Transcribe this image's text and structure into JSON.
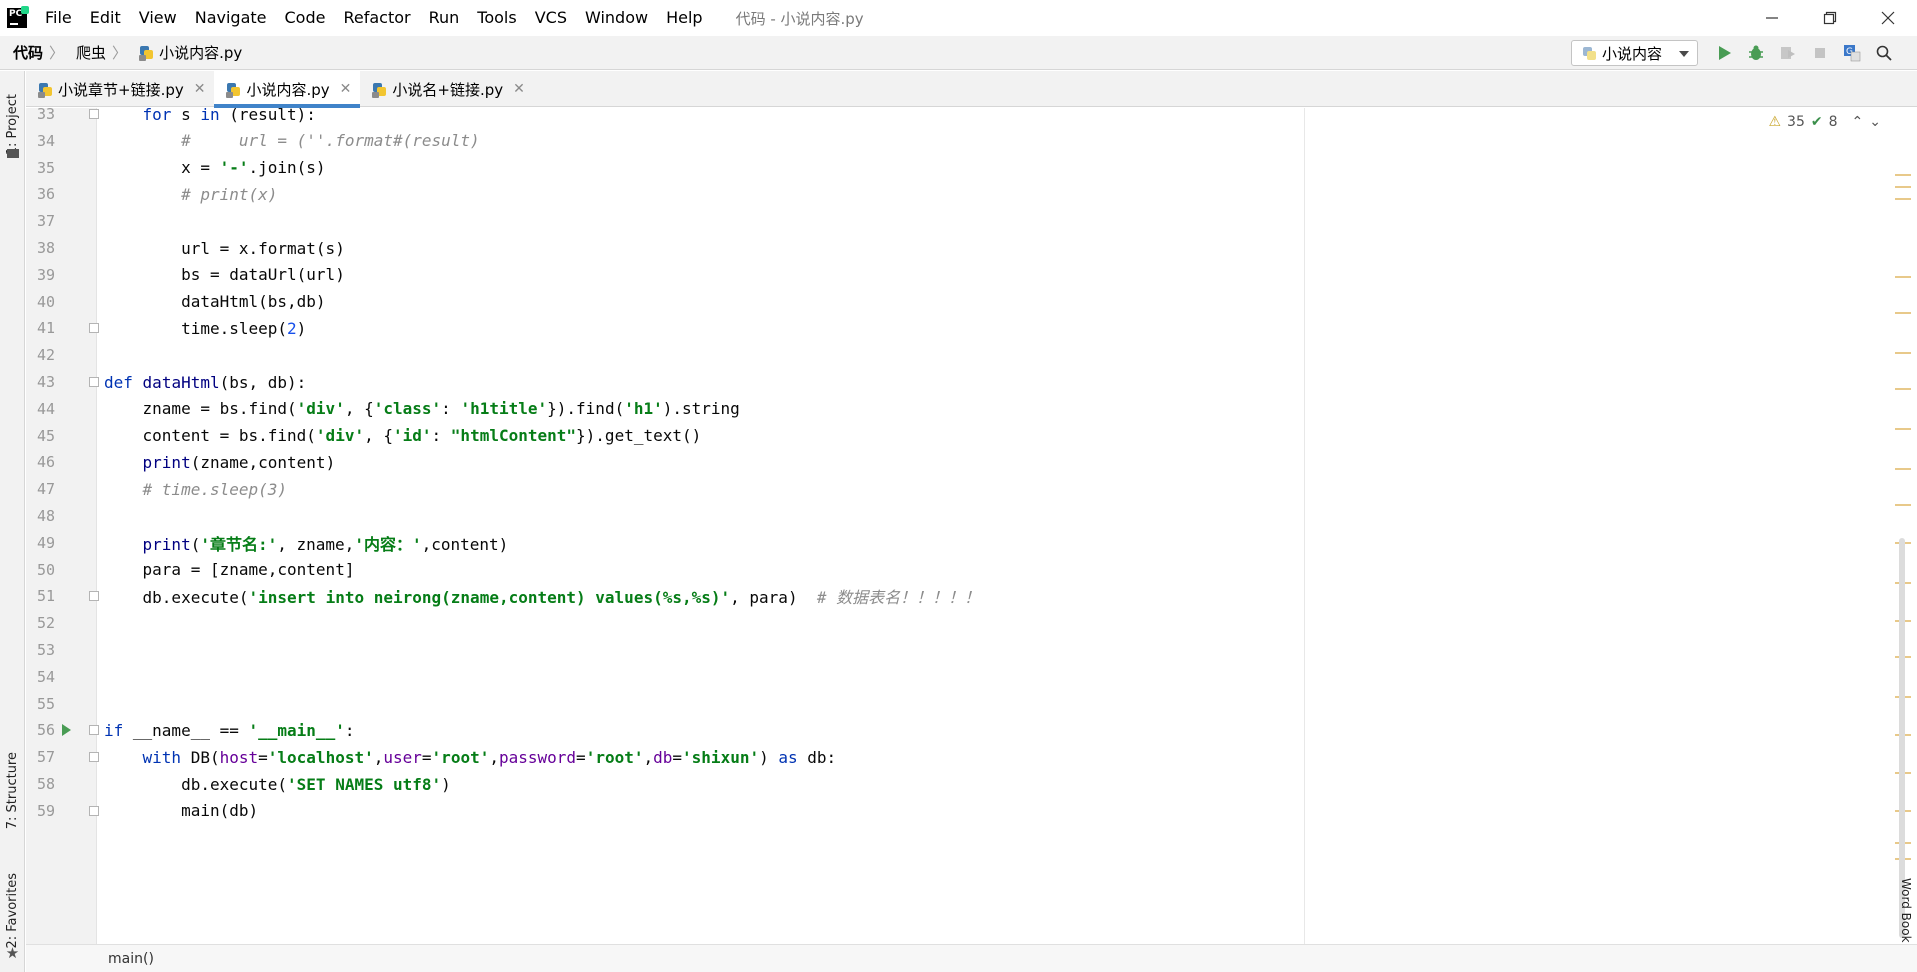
{
  "menu": [
    "File",
    "Edit",
    "View",
    "Navigate",
    "Code",
    "Refactor",
    "Run",
    "Tools",
    "VCS",
    "Window",
    "Help"
  ],
  "window_title": "代码 - 小说内容.py",
  "breadcrumb": [
    "代码",
    "爬虫",
    "小说内容.py"
  ],
  "run_config": "小说内容",
  "left_tabs": {
    "project": "1: Project",
    "structure": "7: Structure",
    "favorites": "2: Favorites"
  },
  "right_tabs": {
    "word_book": "Word Book"
  },
  "tabs": [
    {
      "label": "小说章节+链接.py",
      "active": false
    },
    {
      "label": "小说内容.py",
      "active": true
    },
    {
      "label": "小说名+链接.py",
      "active": false
    }
  ],
  "inspections": {
    "warnings": "35",
    "weak_warnings": "8"
  },
  "code_lines": [
    {
      "n": "33",
      "html": "    <span class='kw'>for</span> s <span class='kw'>in</span> (result):"
    },
    {
      "n": "34",
      "html": "        <span class='cmt'>#     url = (''.format#(result)</span>"
    },
    {
      "n": "35",
      "html": "        x = <span class='str'>'-'</span>.join(s)"
    },
    {
      "n": "36",
      "html": "        <span class='cmt'># print(x)</span>"
    },
    {
      "n": "37",
      "html": ""
    },
    {
      "n": "38",
      "html": "        url = x.format(s)"
    },
    {
      "n": "39",
      "html": "        bs = dataUrl(url)"
    },
    {
      "n": "40",
      "html": "        dataHtml(bs,db)"
    },
    {
      "n": "41",
      "html": "        time.sleep(<span class='num'>2</span>)"
    },
    {
      "n": "42",
      "html": ""
    },
    {
      "n": "43",
      "html": "<span class='kw'>def</span> <span class='fn'>dataHtml</span>(bs, db):"
    },
    {
      "n": "44",
      "html": "    zname = bs.find(<span class='str'>'div'</span>, {<span class='str'>'class'</span>: <span class='str'>'h1title'</span>}).find(<span class='str'>'h1'</span>).string"
    },
    {
      "n": "45",
      "html": "    content = bs.find(<span class='str'>'div'</span>, {<span class='str'>'id'</span>: <span class='str'>\"htmlContent\"</span>}).get_text()"
    },
    {
      "n": "46",
      "html": "    <span class='fn'>print</span>(zname,content)"
    },
    {
      "n": "47",
      "html": "    <span class='cmt'># time.sleep(3)</span>"
    },
    {
      "n": "48",
      "html": ""
    },
    {
      "n": "49",
      "html": "    <span class='fn'>print</span>(<span class='str'>'章节名:'</span>, zname,<span class='str'>'内容：'</span>,content)"
    },
    {
      "n": "50",
      "html": "    para = [zname,content]"
    },
    {
      "n": "51",
      "html": "    db.execute(<span class='str'>'insert into neirong(zname,content) values(%s,%s)'</span>, para)  <span class='cmt'># 数据表名！！！！！</span>"
    },
    {
      "n": "52",
      "html": ""
    },
    {
      "n": "53",
      "html": ""
    },
    {
      "n": "54",
      "html": ""
    },
    {
      "n": "55",
      "html": ""
    },
    {
      "n": "56",
      "html": "<span class='kw'>if</span> __name__ == <span class='str'>'__main__'</span>:"
    },
    {
      "n": "57",
      "html": "    <span class='kw'>with</span> DB(<span class='kwarg'>host</span>=<span class='str'>'localhost'</span>,<span class='kwarg'>user</span>=<span class='str'>'root'</span>,<span class='kwarg'>password</span>=<span class='str'>'root'</span>,<span class='kwarg'>db</span>=<span class='str'>'shixun'</span>) <span class='kw'>as</span> db:"
    },
    {
      "n": "58",
      "html": "        db.execute(<span class='str'>'SET NAMES utf8'</span>)"
    },
    {
      "n": "59",
      "html": "        main(db)"
    }
  ],
  "status_breadcrumb": "main()",
  "colors": {
    "accent": "#4083c9",
    "run_green": "#499c54",
    "keyword": "#0033b3",
    "string": "#067d17",
    "comment": "#8c8c8c"
  }
}
